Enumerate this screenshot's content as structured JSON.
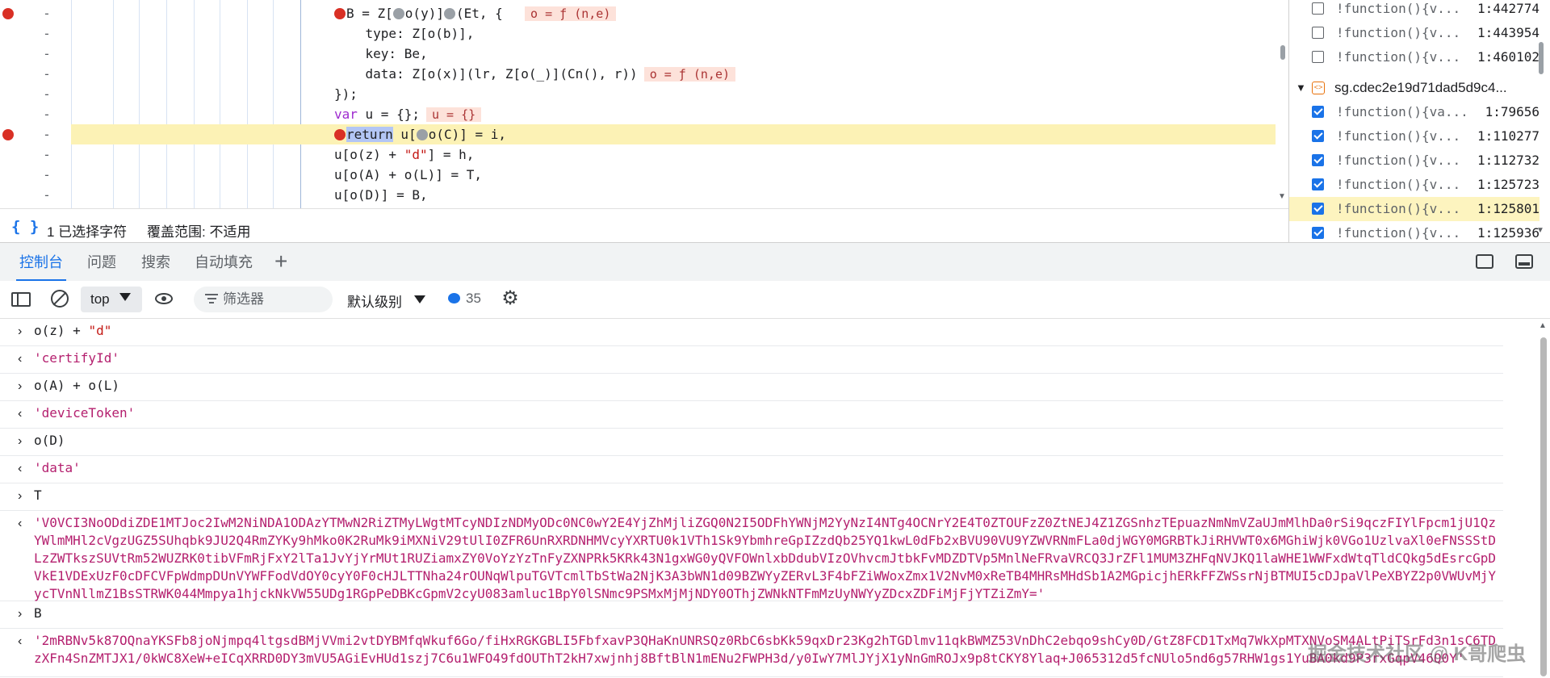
{
  "code": {
    "lines": [
      {
        "breakpoint": true,
        "highlight": false,
        "parts": [
          {
            "t": "bp"
          },
          {
            "t": "txt",
            "v": "B = Z["
          },
          {
            "t": "bpg"
          },
          {
            "t": "txt",
            "v": "o(y)]"
          },
          {
            "t": "bpg"
          },
          {
            "t": "txt",
            "v": "(Et, {  "
          },
          {
            "t": "val",
            "v": "o = ƒ (n,e)"
          }
        ]
      },
      {
        "breakpoint": false,
        "highlight": false,
        "parts": [
          {
            "t": "txt",
            "v": "    type: Z[o(b)],"
          }
        ]
      },
      {
        "breakpoint": false,
        "highlight": false,
        "parts": [
          {
            "t": "txt",
            "v": "    key: Be,"
          }
        ]
      },
      {
        "breakpoint": false,
        "highlight": false,
        "parts": [
          {
            "t": "txt",
            "v": "    data: Z[o(x)](lr, Z[o(_)](Cn(), r))"
          },
          {
            "t": "val",
            "v": "o = ƒ (n,e)"
          }
        ]
      },
      {
        "breakpoint": false,
        "highlight": false,
        "parts": [
          {
            "t": "txt",
            "v": "});"
          }
        ]
      },
      {
        "breakpoint": false,
        "highlight": false,
        "parts": [
          {
            "t": "kw",
            "v": "var"
          },
          {
            "t": "txt",
            "v": " u = {};"
          },
          {
            "t": "val",
            "v": "u = {}"
          }
        ]
      },
      {
        "breakpoint": true,
        "highlight": true,
        "parts": [
          {
            "t": "bp"
          },
          {
            "t": "kwsel",
            "v": "return"
          },
          {
            "t": "txt",
            "v": " u["
          },
          {
            "t": "bpg"
          },
          {
            "t": "txt",
            "v": "o(C)] = i,"
          }
        ]
      },
      {
        "breakpoint": false,
        "highlight": false,
        "parts": [
          {
            "t": "txt",
            "v": "u[o(z) + "
          },
          {
            "t": "str",
            "v": "\"d\""
          },
          {
            "t": "txt",
            "v": "] = h,"
          }
        ]
      },
      {
        "breakpoint": false,
        "highlight": false,
        "parts": [
          {
            "t": "txt",
            "v": "u[o(A) + o(L)] = T,"
          }
        ]
      },
      {
        "breakpoint": false,
        "highlight": false,
        "parts": [
          {
            "t": "txt",
            "v": "u[o(D)] = B,"
          }
        ]
      }
    ],
    "line_number_glyph": "-"
  },
  "status": {
    "pretty_print": "{ }",
    "selected_chars": "1 已选择字符",
    "coverage": "覆盖范围: 不适用"
  },
  "side": {
    "rows_top": [
      {
        "checked": false,
        "name": "!function(){v...",
        "loc": "1:442774"
      },
      {
        "checked": false,
        "name": "!function(){v...",
        "loc": "1:443954"
      },
      {
        "checked": false,
        "name": "!function(){v...",
        "loc": "1:460102"
      }
    ],
    "script_group": "sg.cdec2e19d71dad5d9c4...",
    "rows_bottom": [
      {
        "checked": true,
        "active": false,
        "name": "!function(){va...",
        "loc": "1:79656"
      },
      {
        "checked": true,
        "active": false,
        "name": "!function(){v...",
        "loc": "1:110277"
      },
      {
        "checked": true,
        "active": false,
        "name": "!function(){v...",
        "loc": "1:112732"
      },
      {
        "checked": true,
        "active": false,
        "name": "!function(){v...",
        "loc": "1:125723"
      },
      {
        "checked": true,
        "active": true,
        "name": "!function(){v...",
        "loc": "1:125801"
      },
      {
        "checked": true,
        "active": false,
        "name": "!function(){v...",
        "loc": "1:125936"
      }
    ]
  },
  "drawer": {
    "tabs": [
      "控制台",
      "问题",
      "搜索",
      "自动填充"
    ],
    "active_tab": 0,
    "add_tab": "+"
  },
  "toolbar": {
    "context": "top",
    "filter_placeholder": "筛选器",
    "level": "默认级别",
    "issues_count": "35"
  },
  "console": {
    "messages": [
      {
        "kind": "input",
        "arrow": "›",
        "parts": [
          {
            "t": "txt",
            "v": "o(z) + "
          },
          {
            "t": "str",
            "v": "\"d\""
          }
        ]
      },
      {
        "kind": "result",
        "arrow": "‹",
        "parts": [
          {
            "t": "txt",
            "v": "'certifyId'"
          }
        ]
      },
      {
        "kind": "input",
        "arrow": "›",
        "parts": [
          {
            "t": "txt",
            "v": "o(A) + o(L)"
          }
        ]
      },
      {
        "kind": "result",
        "arrow": "‹",
        "parts": [
          {
            "t": "txt",
            "v": "'deviceToken'"
          }
        ]
      },
      {
        "kind": "input",
        "arrow": "›",
        "parts": [
          {
            "t": "txt",
            "v": "o(D)"
          }
        ]
      },
      {
        "kind": "result",
        "arrow": "‹",
        "parts": [
          {
            "t": "txt",
            "v": "'data'"
          }
        ]
      },
      {
        "kind": "input",
        "arrow": "›",
        "parts": [
          {
            "t": "txt",
            "v": "T"
          }
        ]
      },
      {
        "kind": "result",
        "arrow": "‹",
        "parts": [
          {
            "t": "txt",
            "v": "'V0VCI3NoODdiZDE1MTJoc2IwM2NiNDA1ODAzYTMwN2RiZTMyLWgtMTcyNDIzNDMyODc0NC0wY2E4YjZhMjliZGQ0N2I5ODFhYWNjM2YyNzI4NTg4OCNrY2E4T0ZTOUFzZ0ZtNEJ4Z1ZGSnhzTEpuazNmNmVZaUJmMlhDa0rSi9qczFIYlFpcm1jU1QzYWlmMHl2cVgzUGZ5SUhqbk9JU2Q4RmZYKy9hMko0K2RuMk9iMXNiV29tUlI0ZFR6UnRXRDNHMVcyYXRTU0k1VTh1Sk9YbmhreGpIZzdQb25YQ1kwL0dFb2xBVU90VU9YZWVRNmFLa0djWGY0MGRBTkJiRHVWT0x6MGhiWjk0VGo1UzlvaXl0eFNSSStDLzZWTkszSUVtRm52WUZRK0tibVFmRjFxY2lTa1JvYjYrMUt1RUZiamxZY0VoYzYzTnFyZXNPRk5KRk43N1gxWG0yQVFOWnlxbDdubVIzOVhvcmJtbkFvMDZDTVp5MnlNeFRvaVRCQ3JrZFl1MUM3ZHFqNVJKQ1laWHE1WWFxdWtqTldCQkg5dEsrcGpDVkE1VDExUzF0cDFCVFpWdmpDUnVYWFFodVdOY0cyY0F0cHJLTTNha24rOUNqWlpuTGVTcmlTbStWa2NjK3A3bWN1d09BZWYyZERvL3F4bFZiWWoxZmx1V2NvM0xReTB4MHRsMHdSb1A2MGpicjhERkFFZWSsrNjBTMUI5cDJpaVlPeXBYZ2p0VWUvMjYycTVnNllmZ1BsSTRWK044Mmpya1hjckNkVW55UDg1RGpPeDBKcGpmV2cyU083amluc1BpY0lSNmc9PSMxMjMjNDY0OThjZWNkNTFmMzUyNWYyZDcxZDFiMjFjYTZiZmY='"
          }
        ]
      },
      {
        "kind": "input",
        "arrow": "›",
        "parts": [
          {
            "t": "txt",
            "v": "B"
          }
        ]
      },
      {
        "kind": "result",
        "arrow": "‹",
        "parts": [
          {
            "t": "txt",
            "v": "'2mRBNv5k87OQnaYKSFb8joNjmpq4ltgsdBMjVVmi2vtDYBMfqWkuf6Go/fiHxRGKGBLI5FbfxavP3QHaKnUNRSQz0RbC6sbKk59qxDr23Kg2hTGDlmv11qkBWMZ53VnDhC2ebqo9shCy0D/GtZ8FCD1TxMq7WkXpMTXNVoSM4ALtPiTSrFd3n1sC6TDzXFn4SnZMTJX1/0kWC8XeW+eICqXRRD0DY3mVU5AGiEvHUd1szj7C6u1WFO49fdOUThT2kH7xwjnhj8BftBlN1mENu2FWPH3d/y0IwY7MlJYjX1yNnGmROJx9p8tCKY8Ylaq+J065312d5fcNUlo5nd6g57RHW1gs1YuBA0kd9P3rxGqpV46Q0Y'"
          }
        ]
      }
    ]
  },
  "watermark": "掘金技术社区 @ K哥爬虫"
}
